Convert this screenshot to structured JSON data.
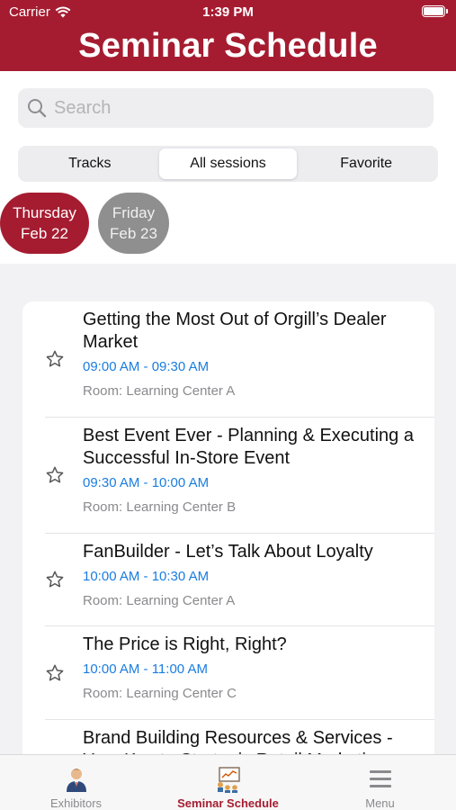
{
  "status_bar": {
    "carrier": "Carrier",
    "time": "1:39 PM"
  },
  "header": {
    "title": "Seminar Schedule"
  },
  "search": {
    "placeholder": "Search",
    "value": ""
  },
  "segments": [
    {
      "label": "Tracks",
      "selected": false
    },
    {
      "label": "All sessions",
      "selected": true
    },
    {
      "label": "Favorite",
      "selected": false
    }
  ],
  "days": [
    {
      "weekday": "Thursday",
      "date": "Feb 22",
      "selected": true
    },
    {
      "weekday": "Friday",
      "date": "Feb 23",
      "selected": false
    }
  ],
  "sessions": [
    {
      "title": "Getting the Most Out of Orgill’s Dealer Market",
      "time": "09:00 AM - 09:30 AM",
      "room": "Room: Learning Center A"
    },
    {
      "title": "Best Event Ever - Planning & Executing a Successful In-Store Event",
      "time": "09:30 AM - 10:00 AM",
      "room": "Room: Learning Center B"
    },
    {
      "title": "FanBuilder - Let’s Talk About Loyalty",
      "time": "10:00 AM - 10:30 AM",
      "room": "Room: Learning Center A"
    },
    {
      "title": "The Price is Right, Right?",
      "time": "10:00 AM - 11:00 AM",
      "room": "Room: Learning Center C"
    },
    {
      "title": "Brand Building Resources & Services - Your Key to Strategic Retail Marketing",
      "time": "",
      "room": ""
    }
  ],
  "tabs": [
    {
      "label": "Exhibitors",
      "icon": "exhibitor-person-icon",
      "active": false
    },
    {
      "label": "Seminar Schedule",
      "icon": "presentation-icon",
      "active": true
    },
    {
      "label": "Menu",
      "icon": "menu-icon",
      "active": false
    }
  ],
  "colors": {
    "brand": "#a51c30",
    "time": "#1a7de0",
    "muted": "#8a8a8e",
    "day_inactive": "#8f8f8f"
  }
}
